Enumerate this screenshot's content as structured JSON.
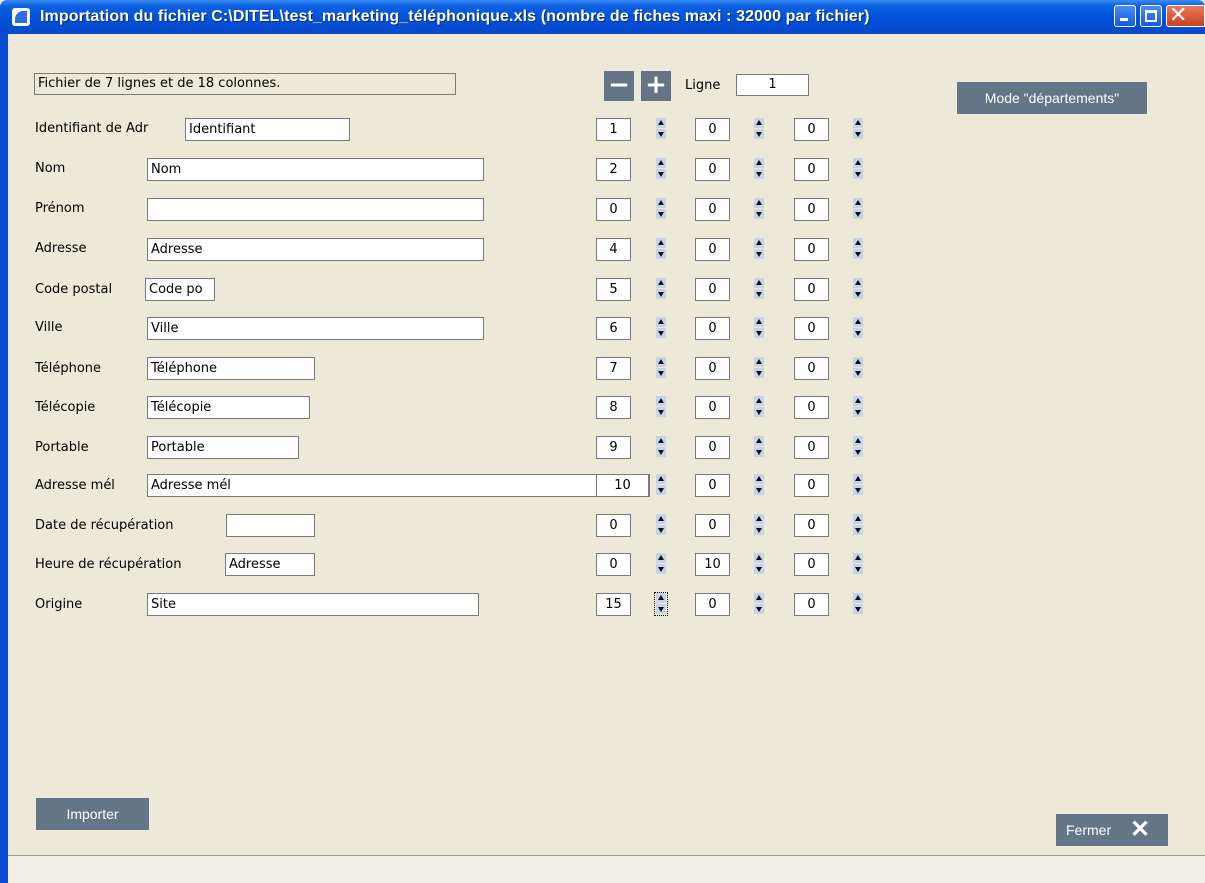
{
  "window": {
    "title": "Importation du fichier C:\\DITEL\\test_marketing_téléphonique.xls (nombre de fiches maxi : 32000 par fichier)"
  },
  "file_info": "Fichier de 7 lignes et de 18 colonnes.",
  "nav": {
    "minus": "−",
    "plus": "+",
    "ligne_label": "Ligne",
    "ligne_value": "1"
  },
  "buttons": {
    "mode": "Mode \"départements\"",
    "import": "Importer",
    "close": "Fermer",
    "close_icon": "✕"
  },
  "rows": [
    {
      "label": "Identifiant de Adr",
      "value": "Identifiant",
      "col1": "1",
      "col2": "0",
      "col3": "0"
    },
    {
      "label": "Nom",
      "value": "Nom",
      "col1": "2",
      "col2": "0",
      "col3": "0"
    },
    {
      "label": "Prénom",
      "value": "",
      "col1": "0",
      "col2": "0",
      "col3": "0"
    },
    {
      "label": "Adresse",
      "value": "Adresse",
      "col1": "4",
      "col2": "0",
      "col3": "0"
    },
    {
      "label": "Code postal",
      "value": "Code po",
      "col1": "5",
      "col2": "0",
      "col3": "0"
    },
    {
      "label": "Ville",
      "value": "Ville",
      "col1": "6",
      "col2": "0",
      "col3": "0"
    },
    {
      "label": "Téléphone",
      "value": "Téléphone",
      "col1": "7",
      "col2": "0",
      "col3": "0"
    },
    {
      "label": "Télécopie",
      "value": "Télécopie",
      "col1": "8",
      "col2": "0",
      "col3": "0"
    },
    {
      "label": "Portable",
      "value": "Portable",
      "col1": "9",
      "col2": "0",
      "col3": "0"
    },
    {
      "label": "Adresse mél",
      "value": "Adresse mél",
      "col1": "10",
      "col2": "0",
      "col3": "0"
    },
    {
      "label": "Date de récupération",
      "value": "",
      "col1": "0",
      "col2": "0",
      "col3": "0"
    },
    {
      "label": "Heure de récupération",
      "value": "Adresse",
      "col1": "0",
      "col2": "10",
      "col3": "0"
    },
    {
      "label": "Origine",
      "value": "Site",
      "col1": "15",
      "col2": "0",
      "col3": "0"
    }
  ]
}
